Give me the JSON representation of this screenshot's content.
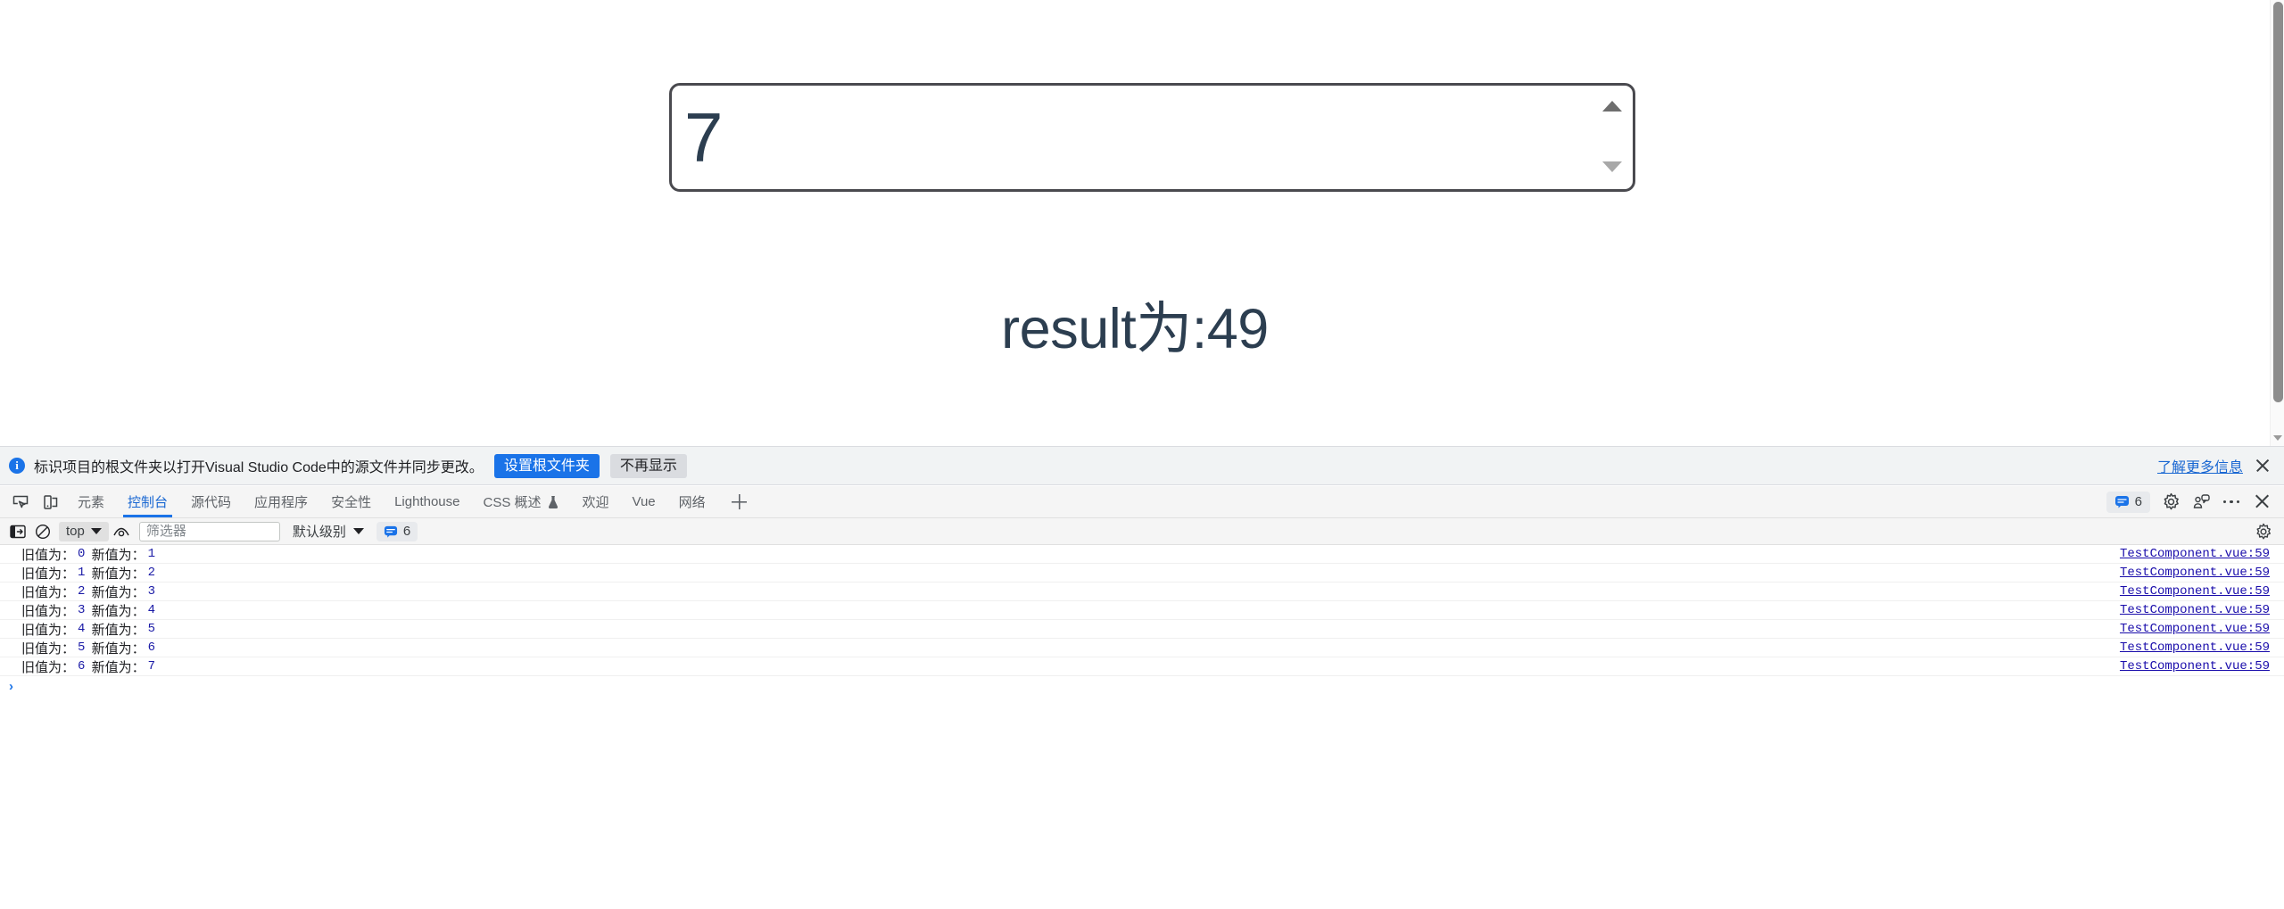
{
  "page": {
    "number_input": {
      "value": "7",
      "spin_up": "spinner-up",
      "spin_down": "spinner-down"
    },
    "result_heading": "result为:49"
  },
  "notification": {
    "icon": "info-icon",
    "text": "标识项目的根文件夹以打开Visual Studio Code中的源文件并同步更改。",
    "primary_button": "设置根文件夹",
    "secondary_button": "不再显示",
    "link": "了解更多信息",
    "close": "close-icon"
  },
  "devtools": {
    "left_icons": [
      "inspect-element-icon",
      "device-toolbar-icon"
    ],
    "tabs": [
      {
        "label": "元素",
        "active": false
      },
      {
        "label": "控制台",
        "active": true
      },
      {
        "label": "源代码",
        "active": false
      },
      {
        "label": "应用程序",
        "active": false
      },
      {
        "label": "安全性",
        "active": false
      },
      {
        "label": "Lighthouse",
        "active": false
      },
      {
        "label": "CSS 概述",
        "active": false,
        "flask": true
      },
      {
        "label": "欢迎",
        "active": false
      },
      {
        "label": "Vue",
        "active": false
      },
      {
        "label": "网络",
        "active": false
      }
    ],
    "add_tab": "add-panel-icon",
    "message_badge_count": "6",
    "right_icons": [
      "settings-gear-icon",
      "feedback-icon",
      "more-options-icon",
      "close-devtools-icon"
    ]
  },
  "console_toolbar": {
    "sidebar_toggle": "console-sidebar-icon",
    "clear_console": "clear-console-icon",
    "context": "top",
    "live_expression": "eye-icon",
    "filter_placeholder": "筛选器",
    "filter_value": "",
    "level": "默认级别",
    "message_count": "6",
    "settings": "console-settings-icon"
  },
  "console_logs": {
    "old_label": "旧值为：",
    "new_label": "新值为：",
    "entries": [
      {
        "old": "0",
        "new": "1",
        "source": "TestComponent.vue:59"
      },
      {
        "old": "1",
        "new": "2",
        "source": "TestComponent.vue:59"
      },
      {
        "old": "2",
        "new": "3",
        "source": "TestComponent.vue:59"
      },
      {
        "old": "3",
        "new": "4",
        "source": "TestComponent.vue:59"
      },
      {
        "old": "4",
        "new": "5",
        "source": "TestComponent.vue:59"
      },
      {
        "old": "5",
        "new": "6",
        "source": "TestComponent.vue:59"
      },
      {
        "old": "6",
        "new": "7",
        "source": "TestComponent.vue:59"
      }
    ],
    "prompt_caret": "›"
  },
  "colors": {
    "accent_blue": "#1a73e8",
    "link_blue": "#1a0dab",
    "text_dark_slate": "#2c3e50",
    "toolbar_bg": "#f5f5f5",
    "notification_bg": "#f1f3f4"
  }
}
